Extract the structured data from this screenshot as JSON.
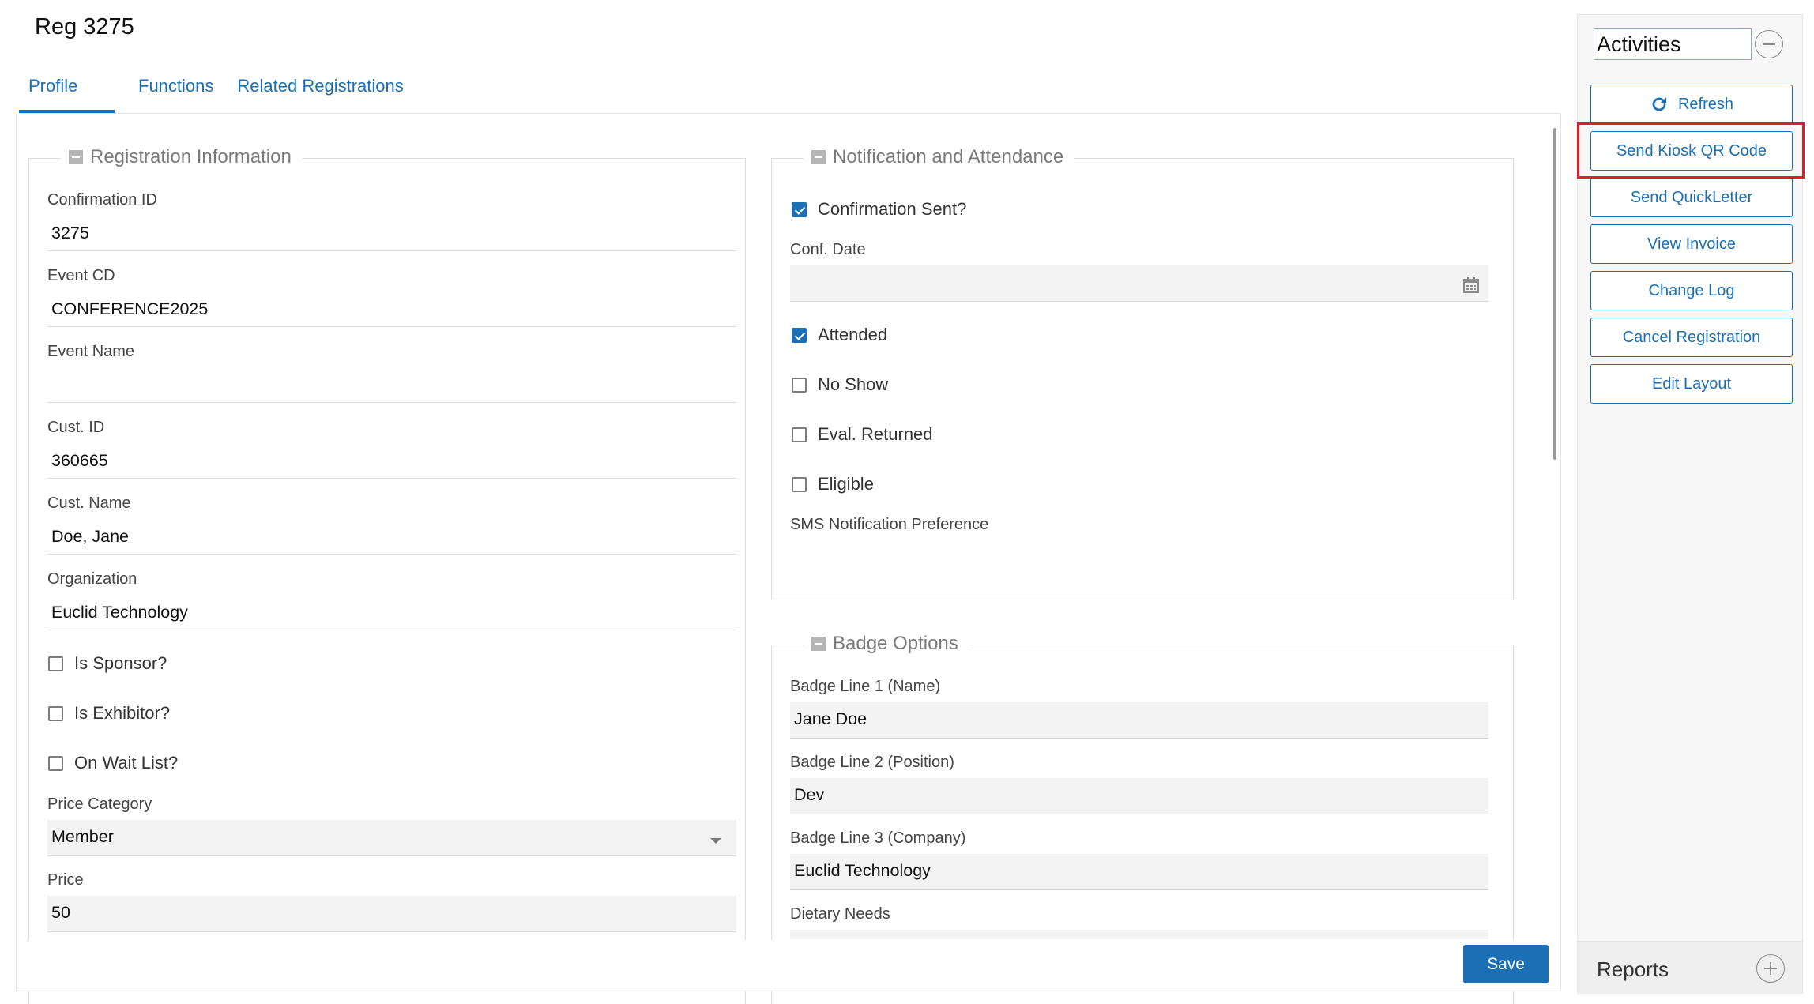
{
  "page": {
    "title": "Reg 3275"
  },
  "tabs": [
    {
      "label": "Profile",
      "active": true
    },
    {
      "label": "Functions",
      "active": false
    },
    {
      "label": "Related Registrations",
      "active": false
    }
  ],
  "registration": {
    "legend": "Registration Information",
    "confirmation_id": {
      "label": "Confirmation ID",
      "value": "3275"
    },
    "event_cd": {
      "label": "Event CD",
      "value": "CONFERENCE2025"
    },
    "event_name": {
      "label": "Event Name",
      "value": ""
    },
    "cust_id": {
      "label": "Cust. ID",
      "value": "360665"
    },
    "cust_name": {
      "label": "Cust. Name",
      "value": "Doe, Jane"
    },
    "organization": {
      "label": "Organization",
      "value": "Euclid Technology"
    },
    "is_sponsor": {
      "label": "Is Sponsor?",
      "checked": false
    },
    "is_exhibitor": {
      "label": "Is Exhibitor?",
      "checked": false
    },
    "on_wait_list": {
      "label": "On Wait List?",
      "checked": false
    },
    "price_category": {
      "label": "Price Category",
      "value": "Member"
    },
    "price": {
      "label": "Price",
      "value": "50"
    }
  },
  "notification": {
    "legend": "Notification and Attendance",
    "confirmation_sent": {
      "label": "Confirmation Sent?",
      "checked": true
    },
    "conf_date": {
      "label": "Conf. Date",
      "value": ""
    },
    "attended": {
      "label": "Attended",
      "checked": true
    },
    "no_show": {
      "label": "No Show",
      "checked": false
    },
    "eval_returned": {
      "label": "Eval. Returned",
      "checked": false
    },
    "eligible": {
      "label": "Eligible",
      "checked": false
    },
    "sms_pref": {
      "label": "SMS Notification Preference"
    }
  },
  "badge": {
    "legend": "Badge Options",
    "line1": {
      "label": "Badge Line 1 (Name)",
      "value": "Jane Doe"
    },
    "line2": {
      "label": "Badge Line 2 (Position)",
      "value": "Dev"
    },
    "line3": {
      "label": "Badge Line 3 (Company)",
      "value": "Euclid Technology"
    },
    "dietary": {
      "label": "Dietary Needs",
      "value": ""
    }
  },
  "save_label": "Save",
  "activities": {
    "title": "Activities",
    "buttons": {
      "refresh": "Refresh",
      "send_kiosk_qr": "Send Kiosk QR Code",
      "send_quickletter": "Send QuickLetter",
      "view_invoice": "View Invoice",
      "change_log": "Change Log",
      "cancel_registration": "Cancel Registration",
      "edit_layout": "Edit Layout"
    }
  },
  "reports": {
    "title": "Reports"
  },
  "colors": {
    "accent": "#1a6fb5",
    "highlight": "#e31b23",
    "filled_bg": "#f3f3f3"
  },
  "icons": [
    "minus-square-icon",
    "calendar-icon",
    "chevron-down-icon",
    "refresh-icon",
    "collapse-circle-icon",
    "expand-circle-icon"
  ]
}
